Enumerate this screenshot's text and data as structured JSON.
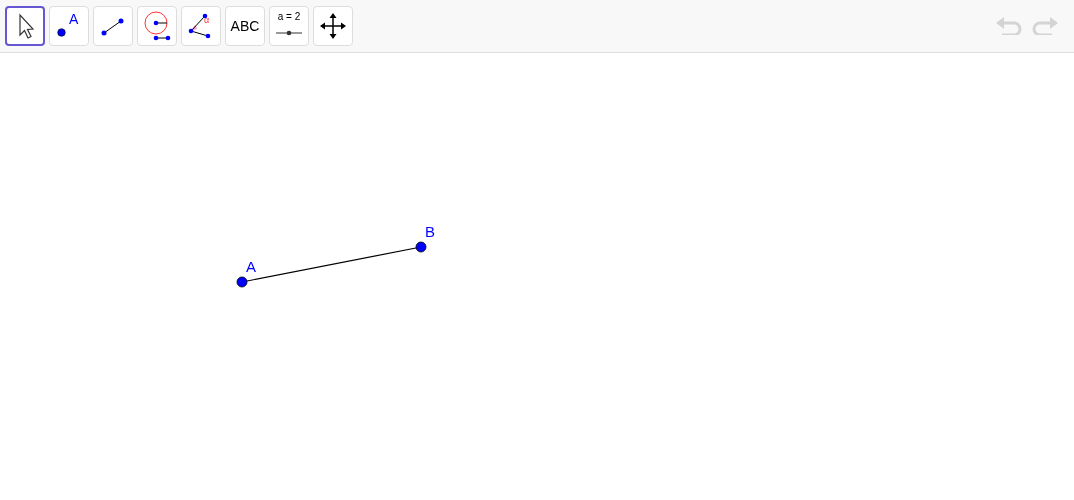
{
  "toolbar": {
    "tools": [
      {
        "kind": "move",
        "selected": true
      },
      {
        "kind": "point",
        "selected": false,
        "glyph": "A"
      },
      {
        "kind": "segment",
        "selected": false
      },
      {
        "kind": "circle",
        "selected": false
      },
      {
        "kind": "angle",
        "selected": false,
        "glyph": "α"
      },
      {
        "kind": "text",
        "selected": false,
        "glyph": "ABC"
      },
      {
        "kind": "slider",
        "selected": false,
        "glyph": "a = 2"
      },
      {
        "kind": "pan",
        "selected": false
      }
    ],
    "history": [
      {
        "kind": "undo",
        "disabled": true
      },
      {
        "kind": "redo",
        "disabled": true
      }
    ]
  },
  "canvas": {
    "points": [
      {
        "label": "A"
      },
      {
        "label": "B"
      }
    ],
    "segments": [
      {
        "kind": "segment"
      }
    ]
  }
}
